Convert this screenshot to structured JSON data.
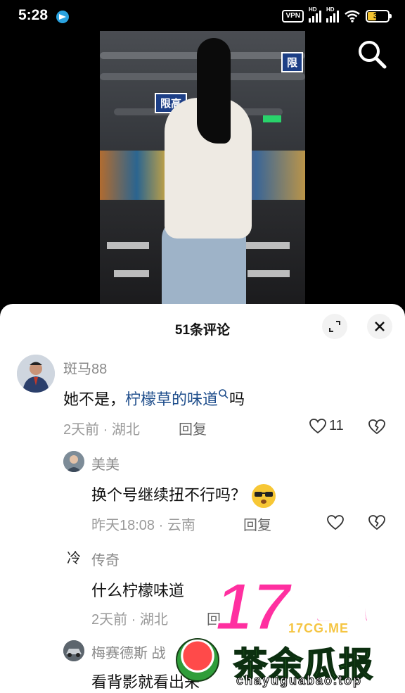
{
  "status_bar": {
    "time": "5:28",
    "vpn": "VPN",
    "hd1": "HD",
    "hd2": "HD",
    "battery": "39",
    "battery_level": 0.39
  },
  "video": {
    "sign_left": "限高",
    "sign_right": "限"
  },
  "comments_panel": {
    "title": "51条评论",
    "comments": [
      {
        "user": "斑马88",
        "text_prefix": "她不是，",
        "text_link": "柠檬草的味道",
        "text_suffix": "吗",
        "time": "2天前",
        "location": "湖北",
        "reply_label": "回复",
        "likes": "11"
      },
      {
        "user": "美美",
        "text": "换个号继续扭不行吗？",
        "time": "昨天18:08",
        "location": "云南",
        "reply_label": "回复"
      },
      {
        "user": "传奇",
        "avatar_text": "冷",
        "text": "什么柠檬味道",
        "time": "2天前",
        "location": "湖北",
        "reply_label": "回"
      },
      {
        "user": "梅赛德斯",
        "user_extra": "战",
        "text": "看背影就看出来"
      }
    ]
  },
  "watermark": {
    "big": "17",
    "chi": "吃瓜",
    "site": "17CG.ME",
    "main": "茶余瓜报",
    "url": "chayuguabao.top"
  },
  "icons": [
    "search-icon",
    "telegram-icon",
    "wifi-icon",
    "expand-icon",
    "close-icon",
    "heart-icon",
    "broken-heart-icon",
    "search-link-icon",
    "sunglasses-emoji-icon",
    "watermelon-icon"
  ]
}
